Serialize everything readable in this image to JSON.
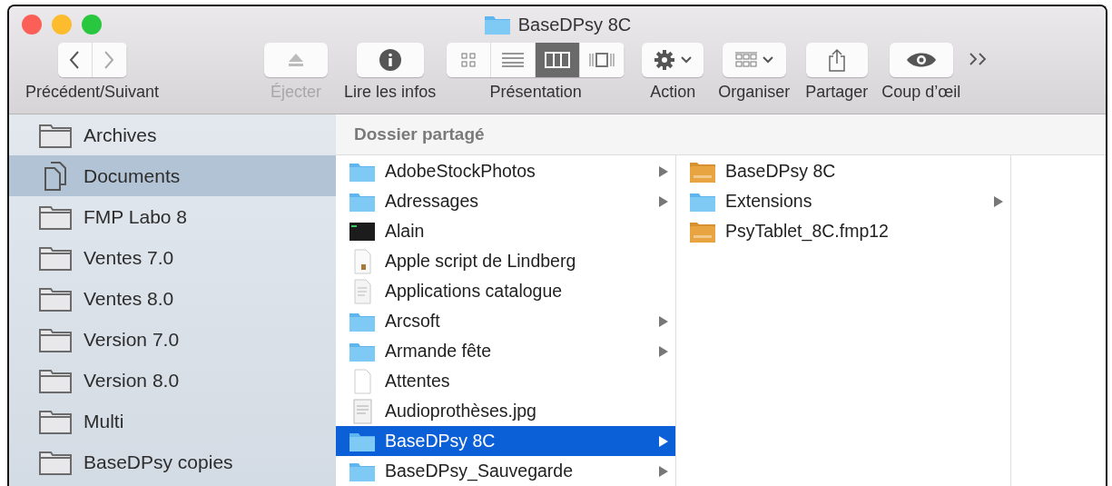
{
  "window": {
    "title": "BaseDPsy 8C"
  },
  "toolbar": [
    {
      "kind": "nav",
      "label": "Précédent/Suivant"
    },
    {
      "kind": "eject",
      "label": "Éjecter",
      "disabled": true
    },
    {
      "kind": "info",
      "label": "Lire les infos"
    },
    {
      "kind": "view",
      "label": "Présentation",
      "views": [
        {
          "kind": "icons",
          "selected": false
        },
        {
          "kind": "list",
          "selected": false
        },
        {
          "kind": "columns",
          "selected": true
        },
        {
          "kind": "gallery",
          "selected": false
        }
      ]
    },
    {
      "kind": "action",
      "label": "Action"
    },
    {
      "kind": "arrange",
      "label": "Organiser"
    },
    {
      "kind": "share",
      "label": "Partager"
    },
    {
      "kind": "quicklook",
      "label": "Coup d’œil"
    },
    {
      "kind": "overflow"
    }
  ],
  "sidebar": {
    "items": [
      {
        "label": "Archives",
        "kind": "folder",
        "selected": false
      },
      {
        "label": "Documents",
        "kind": "documents",
        "selected": true
      },
      {
        "label": "FMP Labo 8",
        "kind": "folder",
        "selected": false
      },
      {
        "label": "Ventes 7.0",
        "kind": "folder",
        "selected": false
      },
      {
        "label": "Ventes 8.0",
        "kind": "folder",
        "selected": false
      },
      {
        "label": "Version 7.0",
        "kind": "folder",
        "selected": false
      },
      {
        "label": "Version 8.0",
        "kind": "folder",
        "selected": false
      },
      {
        "label": "Multi",
        "kind": "folder",
        "selected": false
      },
      {
        "label": "BaseDPsy copies",
        "kind": "folder",
        "selected": false
      }
    ]
  },
  "path_header": "Dossier partagé",
  "columns": [
    {
      "items": [
        {
          "name": "AdobeStockPhotos",
          "kind": "folder",
          "expandable": true,
          "selected": false
        },
        {
          "name": "Adressages",
          "kind": "folder",
          "expandable": true,
          "selected": false
        },
        {
          "name": "Alain",
          "kind": "terminal",
          "expandable": false,
          "selected": false
        },
        {
          "name": "Apple script de Lindberg",
          "kind": "script",
          "expandable": false,
          "selected": false
        },
        {
          "name": "Applications catalogue",
          "kind": "document",
          "expandable": false,
          "selected": false
        },
        {
          "name": "Arcsoft",
          "kind": "folder",
          "expandable": true,
          "selected": false
        },
        {
          "name": "Armande fête",
          "kind": "folder",
          "expandable": true,
          "selected": false
        },
        {
          "name": "Attentes",
          "kind": "blank",
          "expandable": false,
          "selected": false
        },
        {
          "name": "Audioprothèses.jpg",
          "kind": "image",
          "expandable": false,
          "selected": false
        },
        {
          "name": "BaseDPsy 8C",
          "kind": "folder",
          "expandable": true,
          "selected": true
        },
        {
          "name": "BaseDPsy_Sauvegarde",
          "kind": "folder",
          "expandable": true,
          "selected": false
        }
      ]
    },
    {
      "items": [
        {
          "name": "BaseDPsy 8C",
          "kind": "database",
          "expandable": false,
          "selected": false
        },
        {
          "name": "Extensions",
          "kind": "folder",
          "expandable": true,
          "selected": false
        },
        {
          "name": "PsyTablet_8C.fmp12",
          "kind": "database",
          "expandable": false,
          "selected": false
        }
      ]
    }
  ]
}
